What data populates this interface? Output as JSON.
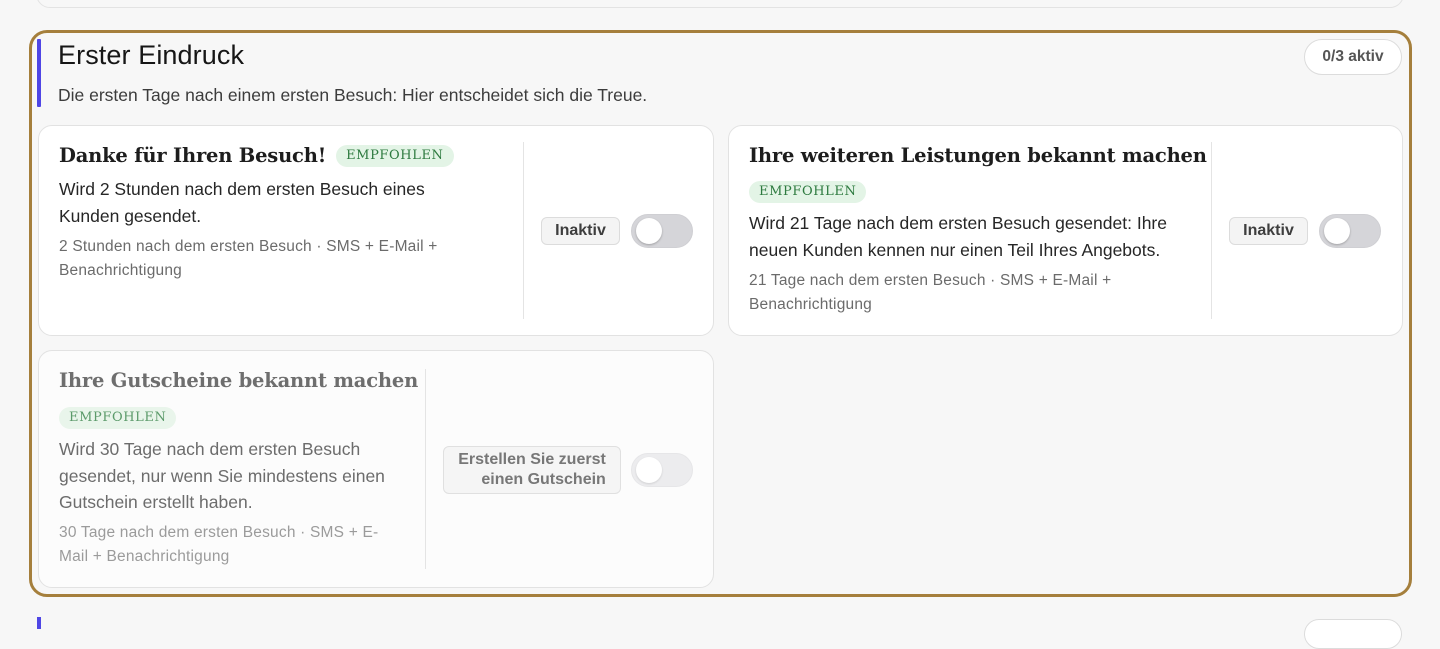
{
  "section": {
    "title": "Erster Eindruck",
    "subtitle": "Die ersten Tage nach einem ersten Besuch: Hier entscheidet sich die Treue.",
    "active_count": "0/3 aktiv",
    "accent_color": "#4f46e5",
    "highlight_border_color": "#a57f3c"
  },
  "cards": [
    {
      "title": "Danke für Ihren Besuch!",
      "badge": "EMPFOHLEN",
      "description_lines": [
        "Wird 2 Stunden nach dem ersten Besuch eines",
        "Kunden gesendet."
      ],
      "meta_lines": [
        "2 Stunden nach dem ersten Besuch · SMS + E-Mail +",
        "Benachrichtigung"
      ],
      "status": "Inaktiv",
      "toggle_on": false
    },
    {
      "title": "Ihre weiteren Leistungen bekannt machen",
      "badge": "EMPFOHLEN",
      "description_lines": [
        "Wird 21 Tage nach dem ersten Besuch gesendet: Ihre",
        "neuen Kunden kennen nur einen Teil Ihres Angebots."
      ],
      "meta_lines": [
        "21 Tage nach dem ersten Besuch · SMS + E-Mail +",
        "Benachrichtigung"
      ],
      "status": "Inaktiv",
      "toggle_on": false
    },
    {
      "title": "Ihre Gutscheine bekannt machen",
      "badge": "EMPFOHLEN",
      "description_lines": [
        "Wird 30 Tage nach dem ersten Besuch",
        "gesendet, nur wenn Sie mindestens einen",
        "Gutschein erstellt haben."
      ],
      "meta_lines": [
        "30 Tage nach dem ersten Besuch · SMS + E-",
        "Mail + Benachrichtigung"
      ],
      "status_lines": [
        "Erstellen Sie zuerst",
        "einen Gutschein"
      ],
      "toggle_on": false,
      "disabled": true
    }
  ]
}
